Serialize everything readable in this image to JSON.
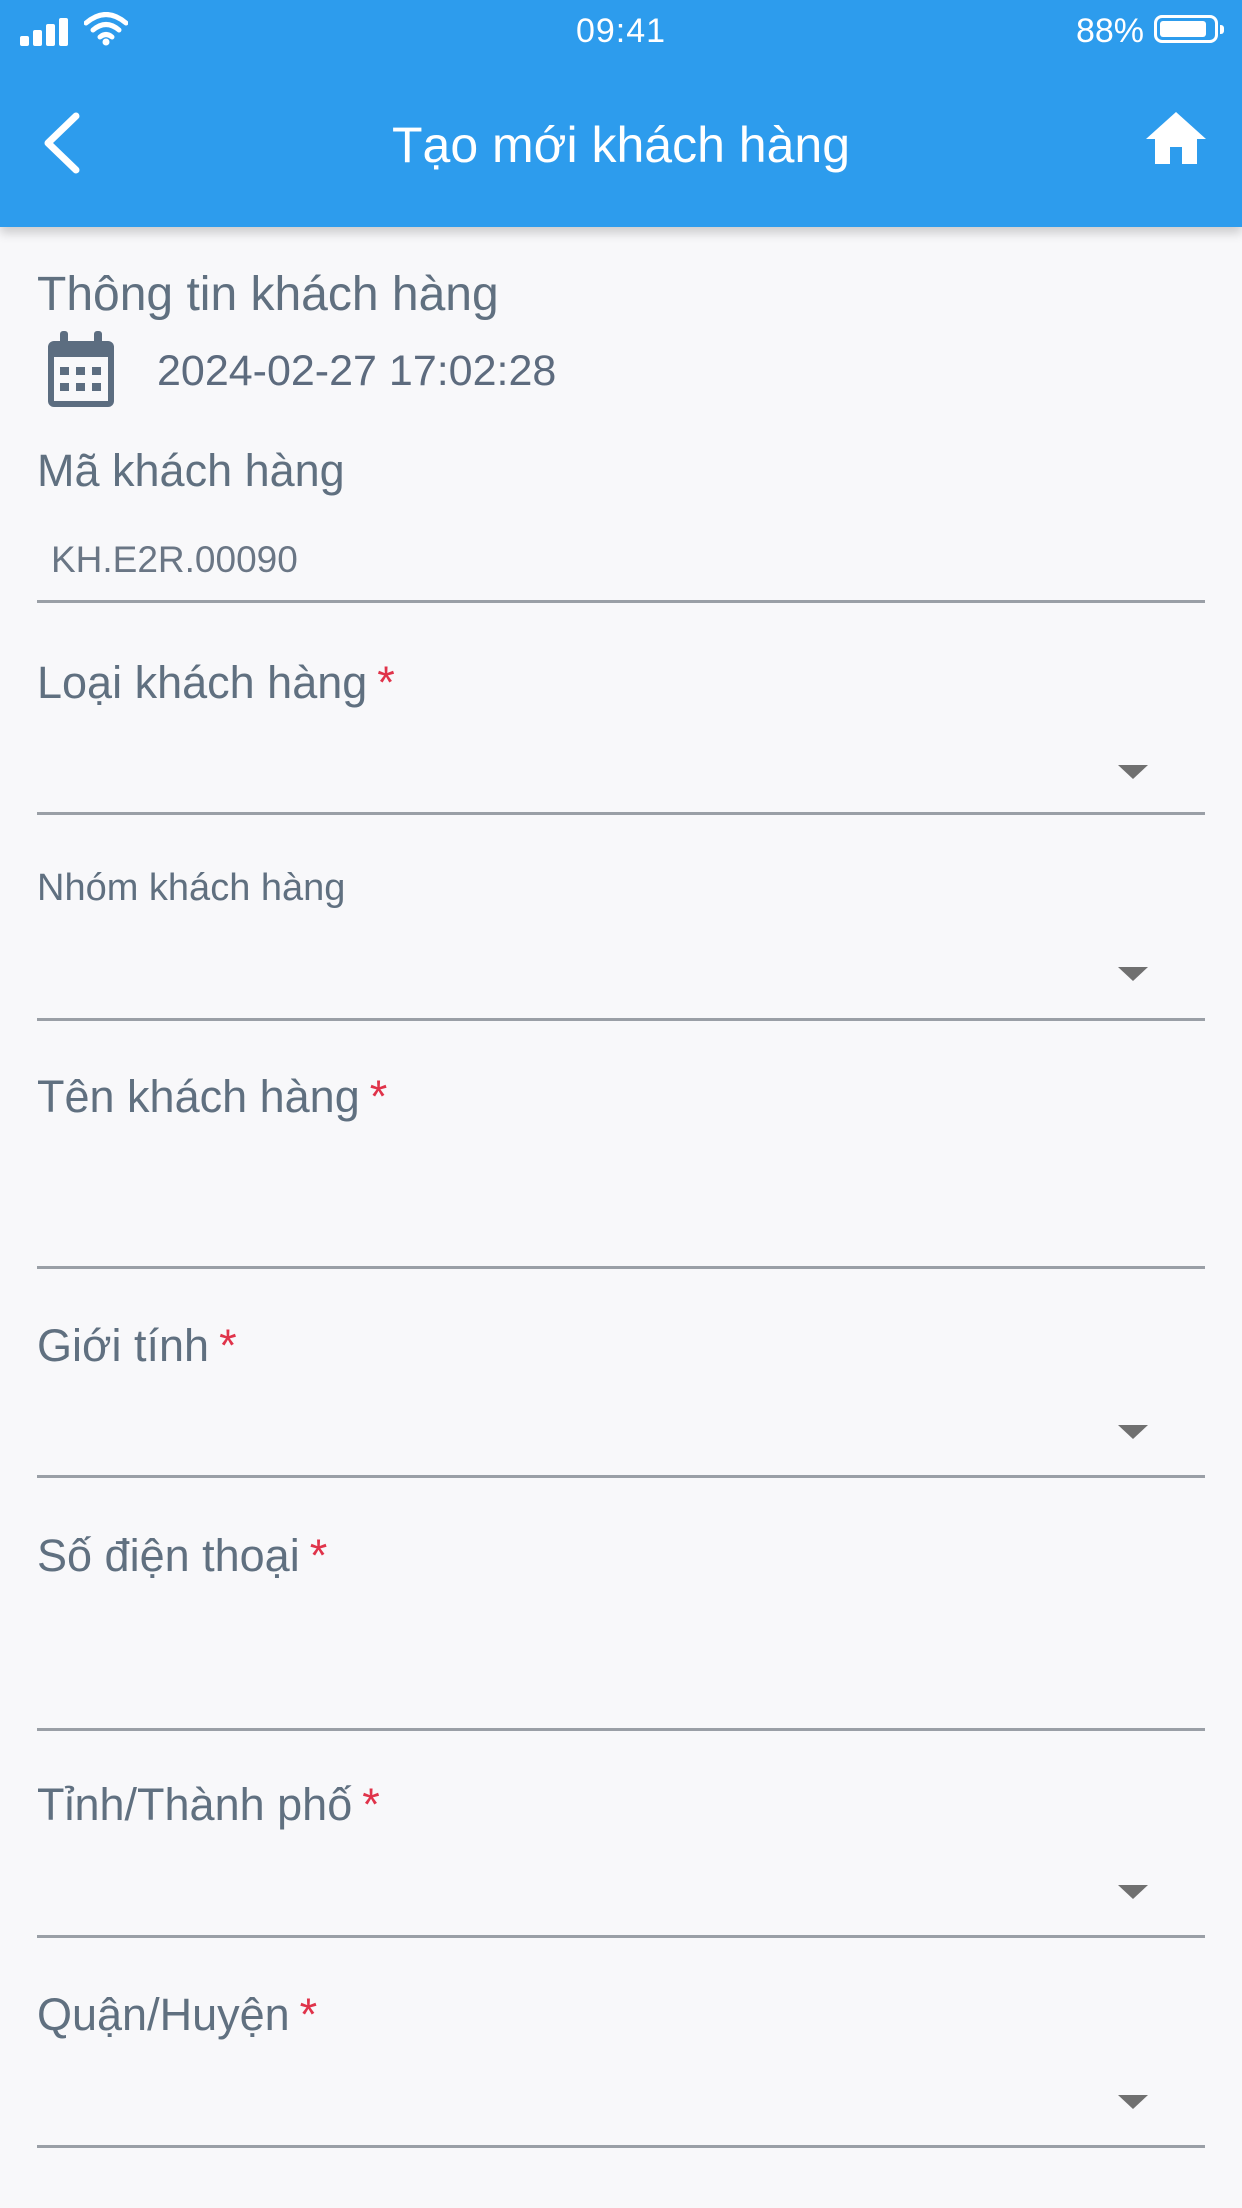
{
  "status_bar": {
    "time": "09:41",
    "battery_percent": "88%",
    "battery_level": 0.88
  },
  "nav": {
    "title": "Tạo mới khách hàng",
    "back_icon": "chevron-left-icon",
    "home_icon": "home-icon"
  },
  "section": {
    "title": "Thông tin khách hàng",
    "datetime": "2024-02-27 17:02:28",
    "calendar_icon": "calendar-icon"
  },
  "fields": {
    "customer_code": {
      "label": "Mã khách hàng",
      "value": "KH.E2R.00090"
    },
    "customer_type": {
      "label": "Loại khách hàng",
      "required": "*"
    },
    "customer_group": {
      "label": "Nhóm khách hàng"
    },
    "customer_name": {
      "label": "Tên khách hàng",
      "required": "*"
    },
    "gender": {
      "label": "Giới tính",
      "required": "*"
    },
    "phone": {
      "label": "Số điện thoại",
      "required": "*"
    },
    "province": {
      "label": "Tỉnh/Thành phố",
      "required": "*"
    },
    "district": {
      "label": "Quận/Huyện",
      "required": "*"
    }
  },
  "colors": {
    "header": "#2d9ced",
    "background": "#f8f8fa",
    "required": "#e0334a",
    "text": "#607080"
  }
}
